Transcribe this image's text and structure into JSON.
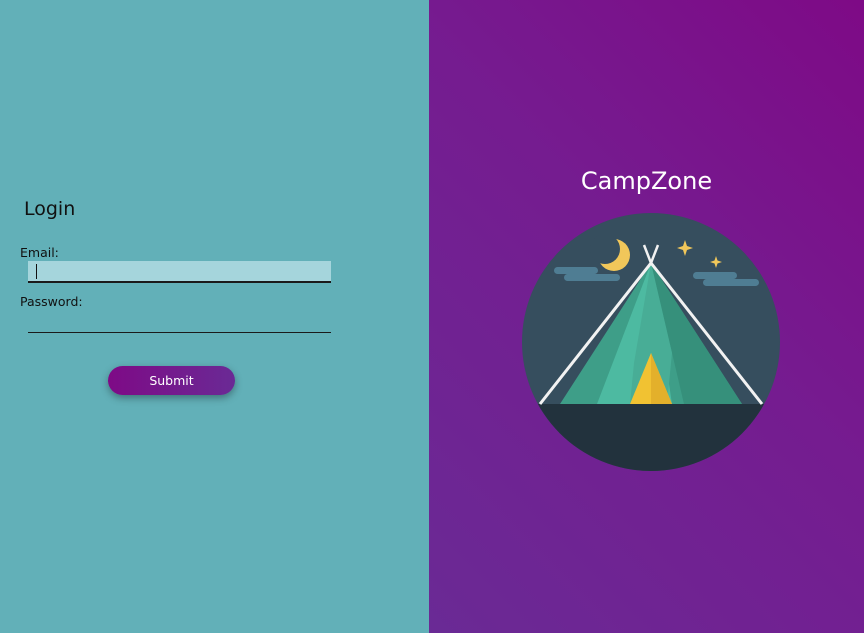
{
  "login": {
    "title": "Login",
    "email_label": "Email:",
    "email_value": "",
    "password_label": "Password:",
    "password_value": "",
    "submit_label": "Submit"
  },
  "brand": {
    "name": "CampZone",
    "logo_icon": "tent-night-icon"
  },
  "colors": {
    "left_background": "#62b0b8",
    "right_gradient_start": "#6a2a95",
    "right_gradient_end": "#7e0a86",
    "email_field_bg": "#a5d5dc"
  }
}
